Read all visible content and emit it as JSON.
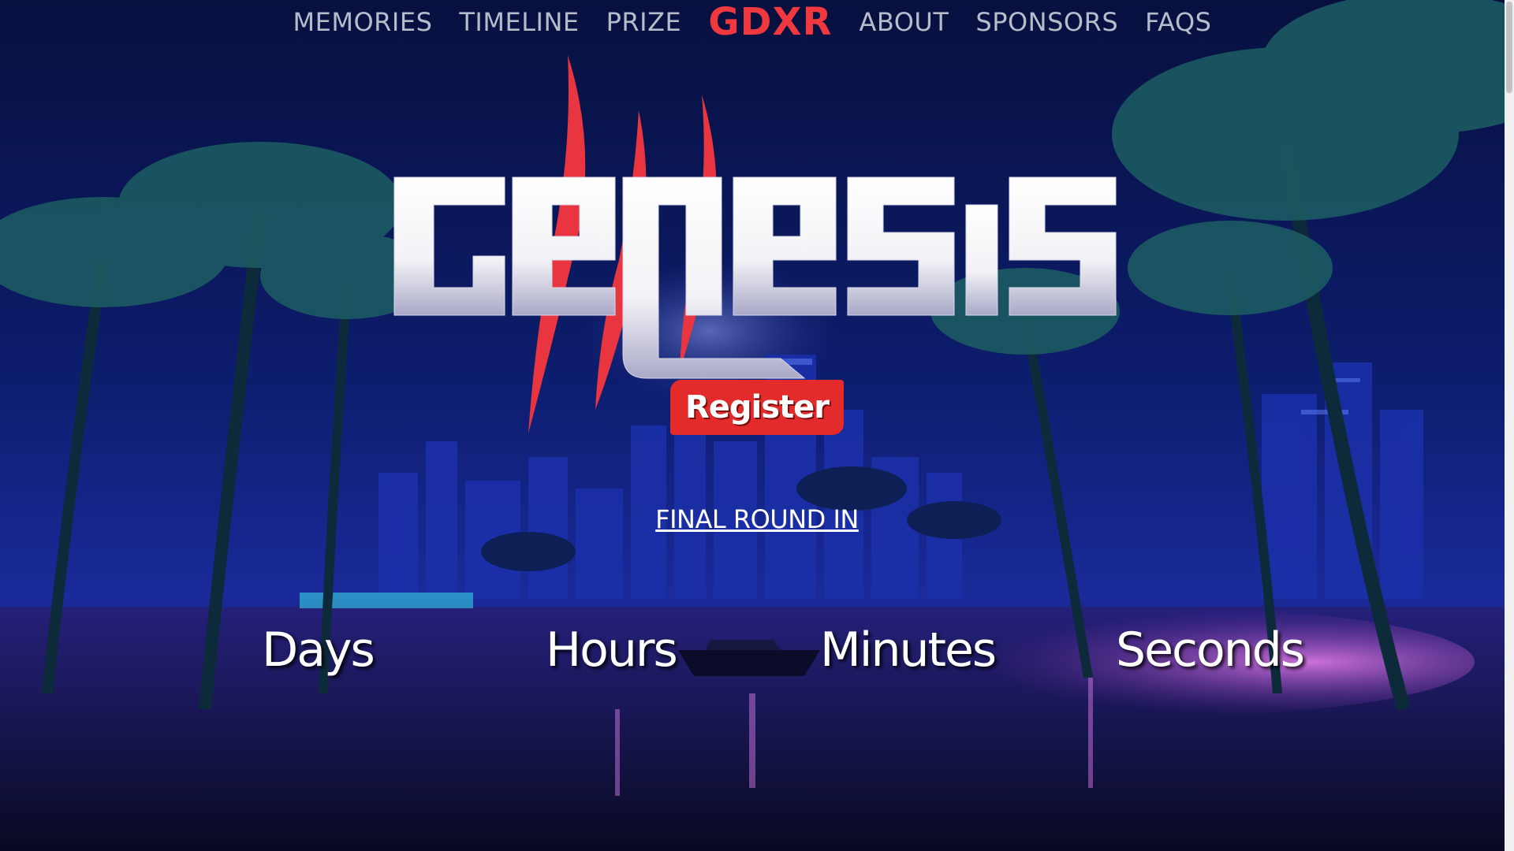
{
  "nav": {
    "items": [
      {
        "label": "MEMORIES"
      },
      {
        "label": "TIMELINE"
      },
      {
        "label": "PRIZE"
      },
      {
        "label": "GDXR"
      },
      {
        "label": "ABOUT"
      },
      {
        "label": "SPONSORS"
      },
      {
        "label": "FAQS"
      }
    ]
  },
  "hero": {
    "logo_text": "GENESIS",
    "register_label": "Register",
    "final_round_label": "FINAL ROUND IN"
  },
  "countdown": {
    "units": [
      "Days",
      "Hours",
      "Minutes",
      "Seconds"
    ]
  },
  "colors": {
    "accent": "#e32b2b",
    "brand": "#f0393f",
    "nav_text": "#b7bccb",
    "sky": "#0a1450"
  }
}
